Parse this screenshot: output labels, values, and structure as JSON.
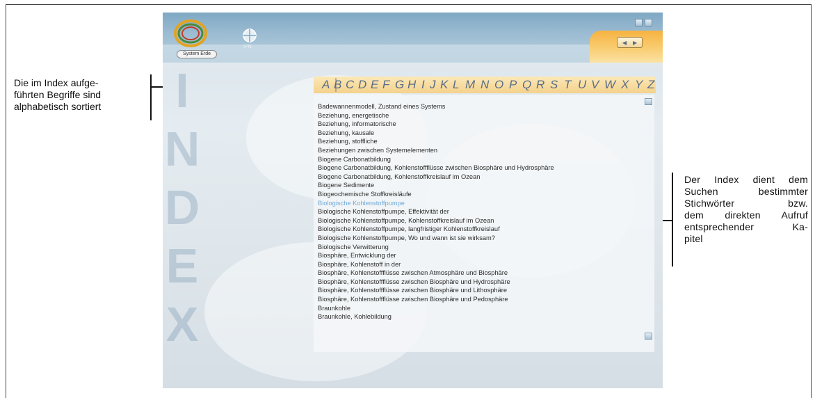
{
  "captions": {
    "left": [
      "Die im Index aufge-",
      "führten Begriffe sind",
      "alphabetisch sortiert"
    ],
    "right": [
      "Der Index dient dem",
      "Suchen bestimmter",
      "Stichwörter bzw.",
      "dem direkten Aufruf",
      "entsprechender Ka-",
      "pitel"
    ]
  },
  "app": {
    "logo_text": "System Erde",
    "ipn_label": "IPN",
    "watermark": "INDEX",
    "nav": {
      "prev_icon": "chevron-left-icon",
      "next_icon": "chevron-right-icon",
      "prev_glyph": "◀",
      "next_glyph": "▶"
    },
    "window_buttons": [
      "minimize",
      "close"
    ]
  },
  "alphabet": [
    "A",
    "B",
    "C",
    "D",
    "E",
    "F",
    "G",
    "H",
    "I",
    "J",
    "K",
    "L",
    "M",
    "N",
    "O",
    "P",
    "Q",
    "R",
    "S",
    "T",
    "U",
    "V",
    "W",
    "X",
    "Y",
    "Z"
  ],
  "selected_letter": "B",
  "entries": [
    "Badewannenmodell, Zustand eines Systems",
    "Beziehung, energetische",
    "Beziehung, informatorische",
    "Beziehung, kausale",
    "Beziehung, stoffliche",
    "Beziehungen zwischen Systemelementen",
    "Biogene Carbonatbildung",
    "Biogene Carbonatbildung, Kohlenstoffflüsse zwischen Biosphäre und Hydrosphäre",
    "Biogene Carbonatbildung, Kohlenstoffkreislauf im Ozean",
    "Biogene Sedimente",
    "Biogeochemische Stoffkreisläufe",
    "Biologische Kohlenstoffpumpe",
    "Biologische Kohlenstoffpumpe, Effektivität der",
    "Biologische Kohlenstoffpumpe, Kohlenstoffkreislauf im Ozean",
    "Biologische Kohlenstoffpumpe, langfristiger Kohlenstoffkreislauf",
    "Biologische Kohlenstoffpumpe, Wo und wann ist sie wirksam?",
    "Biologische Verwitterung",
    "Biosphäre, Entwicklung der",
    "Biosphäre, Kohlenstoff in der",
    "Biosphäre, Kohlenstoffflüsse zwischen Atmosphäre und Biosphäre",
    "Biosphäre, Kohlenstoffflüsse zwischen Biosphäre und Hydrosphäre",
    "Biosphäre, Kohlenstoffflüsse zwischen Biosphäre und Lithosphäre",
    "Biosphäre, Kohlenstoffflüsse zwischen Biosphäre und Pedosphäre",
    "Braunkohle",
    "Braunkohle, Kohlebildung"
  ],
  "active_entry_index": 11,
  "colors": {
    "header": "#8fb3cb",
    "alpha_bar": "#f6d994",
    "alpha_letter": "#5b6d86",
    "active_entry": "#6fa9d8",
    "nav_tab": "#f7be55"
  }
}
